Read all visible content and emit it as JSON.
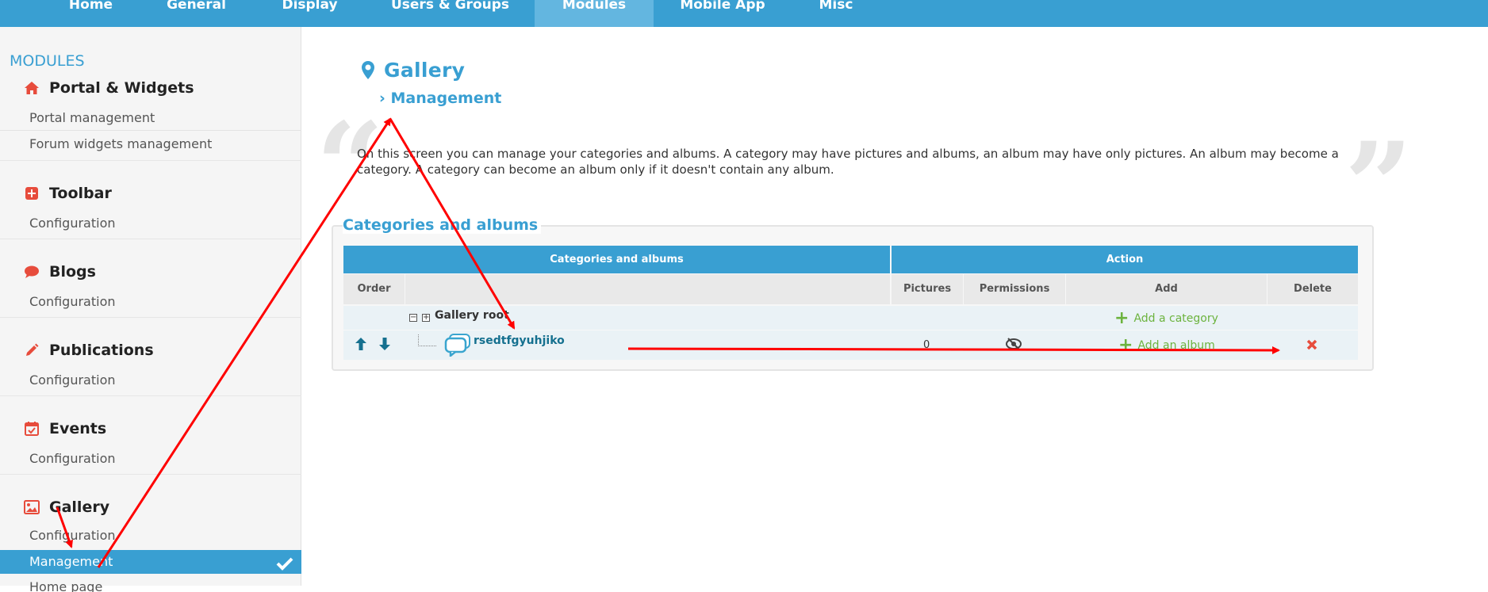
{
  "topnav": {
    "tabs": [
      {
        "label": "Home"
      },
      {
        "label": "General"
      },
      {
        "label": "Display"
      },
      {
        "label": "Users & Groups"
      },
      {
        "label": "Modules"
      },
      {
        "label": "Mobile App"
      },
      {
        "label": "Misc"
      }
    ],
    "active": "Modules"
  },
  "sidebar": {
    "heading": "MODULES",
    "sections": [
      {
        "title": "Portal & Widgets",
        "icon": "home-icon",
        "items": [
          "Portal management",
          "Forum widgets management"
        ]
      },
      {
        "title": "Toolbar",
        "icon": "plus-square-icon",
        "items": [
          "Configuration"
        ]
      },
      {
        "title": "Blogs",
        "icon": "comment-icon",
        "items": [
          "Configuration"
        ]
      },
      {
        "title": "Publications",
        "icon": "pencil-icon",
        "items": [
          "Configuration"
        ]
      },
      {
        "title": "Events",
        "icon": "calendar-icon",
        "items": [
          "Configuration"
        ]
      },
      {
        "title": "Gallery",
        "icon": "image-icon",
        "items": [
          "Configuration",
          "Management",
          "Home page"
        ]
      }
    ],
    "active_item": "Management"
  },
  "main": {
    "title": "Gallery",
    "subtitle": "Management",
    "description": "On this screen you can manage your categories and albums. A category may have pictures and albums, an album may have only pictures. An album may become a category. A category can become an album only if it doesn't contain any album.",
    "fieldset_legend": "Categories and albums",
    "table": {
      "group_headers": [
        "Categories and albums",
        "Action"
      ],
      "column_headers": [
        "Order",
        "",
        "Pictures",
        "Permissions",
        "Add",
        "Delete"
      ],
      "root_row": {
        "label": "Gallery root",
        "add_link": "Add a category"
      },
      "album_row": {
        "name": "rsedtfgyuhjiko",
        "pictures": "0",
        "add_link": "Add an album"
      }
    }
  },
  "colors": {
    "primary": "#399fd2",
    "green": "#6cb33e",
    "red": "#e74c3c",
    "annotation": "#ff0000"
  }
}
